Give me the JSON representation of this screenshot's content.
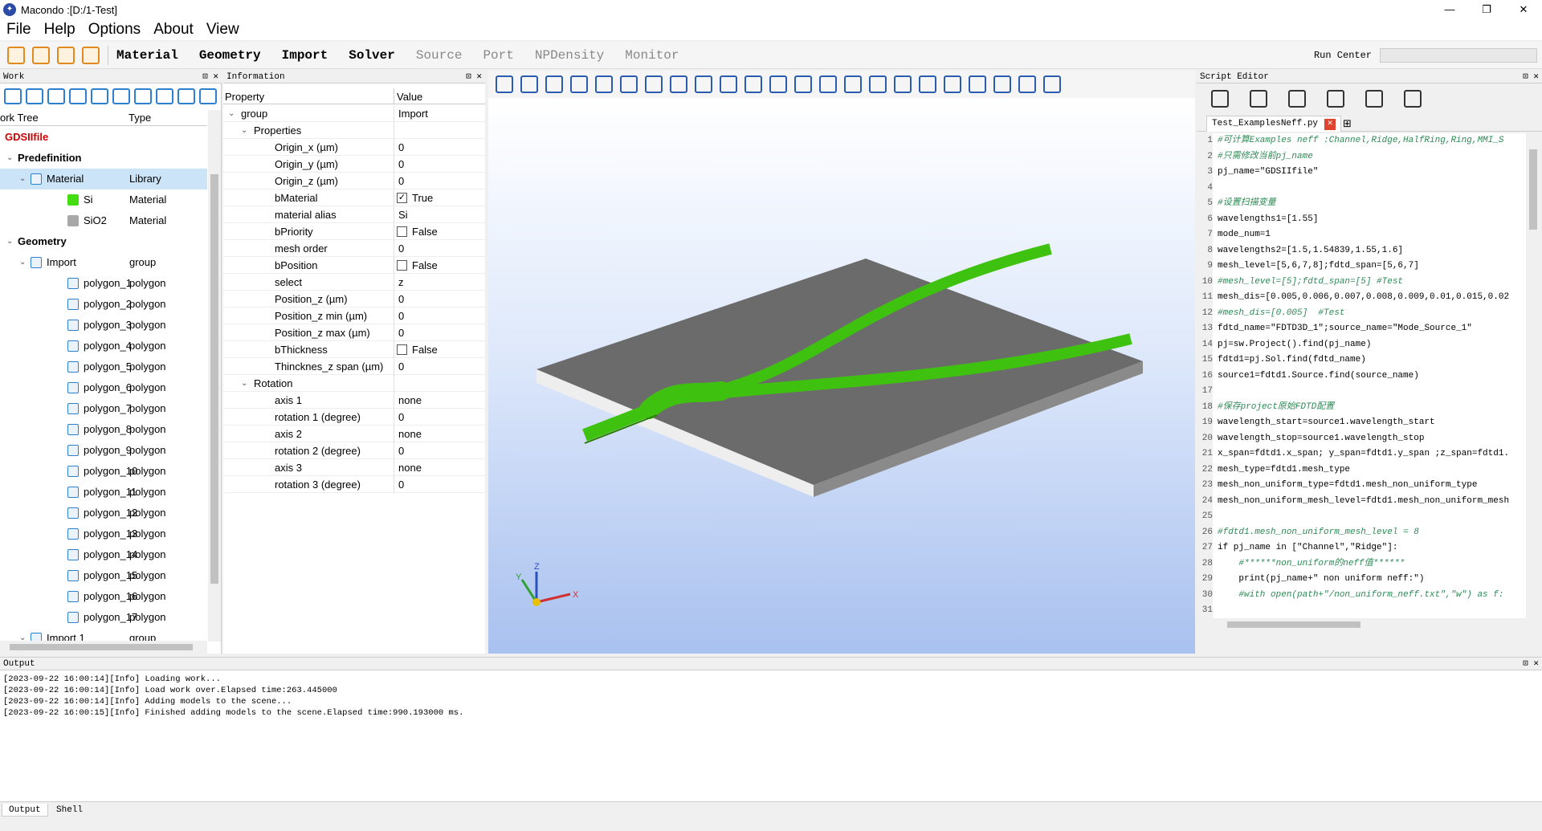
{
  "window": {
    "title": "Macondo :[D:/1-Test]",
    "controls": [
      "—",
      "❐",
      "✕"
    ]
  },
  "menubar": {
    "items": [
      "File",
      "Help",
      "Options",
      "About",
      "View"
    ]
  },
  "toolbar": {
    "menus": [
      {
        "label": "Material",
        "enabled": true
      },
      {
        "label": "Geometry",
        "enabled": true
      },
      {
        "label": "Import",
        "enabled": true
      },
      {
        "label": "Solver",
        "enabled": true
      },
      {
        "label": "Source",
        "enabled": false
      },
      {
        "label": "Port",
        "enabled": false
      },
      {
        "label": "NPDensity",
        "enabled": false
      },
      {
        "label": "Monitor",
        "enabled": false
      }
    ],
    "run_center_label": "Run Center"
  },
  "work": {
    "panel_title": "Work",
    "controls": "⊡ ✕",
    "col_tree": "ork Tree",
    "col_type": "Type",
    "rows": [
      {
        "label": "GDSIIfile",
        "type": "",
        "level": 0,
        "arrow": "",
        "icon": "",
        "style": "root"
      },
      {
        "label": "Predefinition",
        "type": "",
        "level": 0,
        "arrow": "⌄",
        "icon": "",
        "style": "bold"
      },
      {
        "label": "Material",
        "type": "Library",
        "level": 1,
        "arrow": "⌄",
        "icon": "material-icon",
        "style": "sel"
      },
      {
        "label": "Si",
        "type": "Material",
        "level": 2,
        "arrow": "",
        "icon": "si-swatch",
        "style": ""
      },
      {
        "label": "SiO2",
        "type": "Material",
        "level": 2,
        "arrow": "",
        "icon": "sio2-swatch",
        "style": ""
      },
      {
        "label": "Geometry",
        "type": "",
        "level": 0,
        "arrow": "⌄",
        "icon": "",
        "style": "bold"
      },
      {
        "label": "Import",
        "type": "group",
        "level": 1,
        "arrow": "⌄",
        "icon": "group-icon",
        "style": ""
      },
      {
        "label": "polygon_1",
        "type": "polygon",
        "level": 2,
        "arrow": "",
        "icon": "polygon-icon",
        "style": ""
      },
      {
        "label": "polygon_2",
        "type": "polygon",
        "level": 2,
        "arrow": "",
        "icon": "polygon-icon",
        "style": ""
      },
      {
        "label": "polygon_3",
        "type": "polygon",
        "level": 2,
        "arrow": "",
        "icon": "polygon-icon",
        "style": ""
      },
      {
        "label": "polygon_4",
        "type": "polygon",
        "level": 2,
        "arrow": "",
        "icon": "polygon-icon",
        "style": ""
      },
      {
        "label": "polygon_5",
        "type": "polygon",
        "level": 2,
        "arrow": "",
        "icon": "polygon-icon",
        "style": ""
      },
      {
        "label": "polygon_6",
        "type": "polygon",
        "level": 2,
        "arrow": "",
        "icon": "polygon-icon",
        "style": ""
      },
      {
        "label": "polygon_7",
        "type": "polygon",
        "level": 2,
        "arrow": "",
        "icon": "polygon-icon",
        "style": ""
      },
      {
        "label": "polygon_8",
        "type": "polygon",
        "level": 2,
        "arrow": "",
        "icon": "polygon-icon",
        "style": ""
      },
      {
        "label": "polygon_9",
        "type": "polygon",
        "level": 2,
        "arrow": "",
        "icon": "polygon-icon",
        "style": ""
      },
      {
        "label": "polygon_10",
        "type": "polygon",
        "level": 2,
        "arrow": "",
        "icon": "polygon-icon",
        "style": ""
      },
      {
        "label": "polygon_11",
        "type": "polygon",
        "level": 2,
        "arrow": "",
        "icon": "polygon-icon",
        "style": ""
      },
      {
        "label": "polygon_12",
        "type": "polygon",
        "level": 2,
        "arrow": "",
        "icon": "polygon-icon",
        "style": ""
      },
      {
        "label": "polygon_13",
        "type": "polygon",
        "level": 2,
        "arrow": "",
        "icon": "polygon-icon",
        "style": ""
      },
      {
        "label": "polygon_14",
        "type": "polygon",
        "level": 2,
        "arrow": "",
        "icon": "polygon-icon",
        "style": ""
      },
      {
        "label": "polygon_15",
        "type": "polygon",
        "level": 2,
        "arrow": "",
        "icon": "polygon-icon",
        "style": ""
      },
      {
        "label": "polygon_16",
        "type": "polygon",
        "level": 2,
        "arrow": "",
        "icon": "polygon-icon",
        "style": ""
      },
      {
        "label": "polygon_17",
        "type": "polygon",
        "level": 2,
        "arrow": "",
        "icon": "polygon-icon",
        "style": ""
      },
      {
        "label": "Import 1",
        "type": "group",
        "level": 1,
        "arrow": "⌄",
        "icon": "group-icon",
        "style": ""
      }
    ],
    "colors": {
      "si": "#44dd11",
      "sio2": "#a8a8a8",
      "selection": "#cce4f7"
    }
  },
  "info": {
    "panel_title": "Information",
    "controls": "⊡ ✕",
    "col_property": "Property",
    "col_value": "Value",
    "rows": [
      {
        "k": "group",
        "v": "Import",
        "level": 0,
        "arrow": "⌄",
        "check": null
      },
      {
        "k": "Properties",
        "v": "",
        "level": 1,
        "arrow": "⌄",
        "check": null
      },
      {
        "k": "Origin_x (µm)",
        "v": "0",
        "level": 2,
        "arrow": "",
        "check": null
      },
      {
        "k": "Origin_y (µm)",
        "v": "0",
        "level": 2,
        "arrow": "",
        "check": null
      },
      {
        "k": "Origin_z (µm)",
        "v": "0",
        "level": 2,
        "arrow": "",
        "check": null
      },
      {
        "k": "bMaterial",
        "v": "True",
        "level": 2,
        "arrow": "",
        "check": true
      },
      {
        "k": "material alias",
        "v": "Si",
        "level": 2,
        "arrow": "",
        "check": null
      },
      {
        "k": "bPriority",
        "v": "False",
        "level": 2,
        "arrow": "",
        "check": false
      },
      {
        "k": "mesh order",
        "v": "0",
        "level": 2,
        "arrow": "",
        "check": null
      },
      {
        "k": "bPosition",
        "v": "False",
        "level": 2,
        "arrow": "",
        "check": false
      },
      {
        "k": "select",
        "v": "z",
        "level": 2,
        "arrow": "",
        "check": null
      },
      {
        "k": "Position_z (µm)",
        "v": "0",
        "level": 2,
        "arrow": "",
        "check": null
      },
      {
        "k": "Position_z min (µm)",
        "v": "0",
        "level": 2,
        "arrow": "",
        "check": null
      },
      {
        "k": "Position_z max (µm)",
        "v": "0",
        "level": 2,
        "arrow": "",
        "check": null
      },
      {
        "k": "bThickness",
        "v": "False",
        "level": 2,
        "arrow": "",
        "check": false
      },
      {
        "k": "Thincknes_z span (µm)",
        "v": "0",
        "level": 2,
        "arrow": "",
        "check": null
      },
      {
        "k": "Rotation",
        "v": "",
        "level": 1,
        "arrow": "⌄",
        "check": null
      },
      {
        "k": "axis 1",
        "v": "none",
        "level": 2,
        "arrow": "",
        "check": null
      },
      {
        "k": "rotation 1 (degree)",
        "v": "0",
        "level": 2,
        "arrow": "",
        "check": null
      },
      {
        "k": "axis 2",
        "v": "none",
        "level": 2,
        "arrow": "",
        "check": null
      },
      {
        "k": "rotation 2 (degree)",
        "v": "0",
        "level": 2,
        "arrow": "",
        "check": null
      },
      {
        "k": "axis 3",
        "v": "none",
        "level": 2,
        "arrow": "",
        "check": null
      },
      {
        "k": "rotation 3 (degree)",
        "v": "0",
        "level": 2,
        "arrow": "",
        "check": null
      }
    ]
  },
  "viewport": {
    "axis_labels": {
      "x": "X",
      "y": "Y",
      "z": "Z"
    },
    "colors": {
      "substrate": "#6b6b6b",
      "waveguide": "#3fc20f",
      "bg_top": "#ffffff",
      "bg_bottom": "#a9c1ef"
    }
  },
  "script": {
    "panel_title": "Script Editor",
    "controls": "⊡ ✕",
    "tab_label": "Test_ExamplesNeff.py",
    "tab_close": "✕",
    "tab_add": "⊞",
    "current_line": 4,
    "lines": [
      {
        "n": "1",
        "t": "#可计算Examples neff :Channel,Ridge,HalfRing,Ring,MMI_S",
        "c": "cm"
      },
      {
        "n": "2",
        "t": "#只需修改当前pj_name",
        "c": "cm"
      },
      {
        "n": "3",
        "t": "pj_name=\"GDSIIfile\"",
        "c": ""
      },
      {
        "n": "4",
        "t": "",
        "c": ""
      },
      {
        "n": "5",
        "t": "#设置扫描变量",
        "c": "cm"
      },
      {
        "n": "6",
        "t": "wavelengths1=[1.55]",
        "c": ""
      },
      {
        "n": "7",
        "t": "mode_num=1",
        "c": ""
      },
      {
        "n": "8",
        "t": "wavelengths2=[1.5,1.54839,1.55,1.6]",
        "c": ""
      },
      {
        "n": "9",
        "t": "mesh_level=[5,6,7,8];fdtd_span=[5,6,7]",
        "c": ""
      },
      {
        "n": "10",
        "t": "#mesh_level=[5];fdtd_span=[5] #Test",
        "c": "cm"
      },
      {
        "n": "11",
        "t": "mesh_dis=[0.005,0.006,0.007,0.008,0.009,0.01,0.015,0.02",
        "c": ""
      },
      {
        "n": "12",
        "t": "#mesh_dis=[0.005]  #Test",
        "c": "cm"
      },
      {
        "n": "13",
        "t": "fdtd_name=\"FDTD3D_1\";source_name=\"Mode_Source_1\"",
        "c": ""
      },
      {
        "n": "14",
        "t": "pj=sw.Project().find(pj_name)",
        "c": ""
      },
      {
        "n": "15",
        "t": "fdtd1=pj.Sol.find(fdtd_name)",
        "c": ""
      },
      {
        "n": "16",
        "t": "source1=fdtd1.Source.find(source_name)",
        "c": ""
      },
      {
        "n": "17",
        "t": "",
        "c": ""
      },
      {
        "n": "18",
        "t": "#保存project原始FDTD配置",
        "c": "cm"
      },
      {
        "n": "19",
        "t": "wavelength_start=source1.wavelength_start",
        "c": ""
      },
      {
        "n": "20",
        "t": "wavelength_stop=source1.wavelength_stop",
        "c": ""
      },
      {
        "n": "21",
        "t": "x_span=fdtd1.x_span; y_span=fdtd1.y_span ;z_span=fdtd1.",
        "c": ""
      },
      {
        "n": "22",
        "t": "mesh_type=fdtd1.mesh_type",
        "c": ""
      },
      {
        "n": "23",
        "t": "mesh_non_uniform_type=fdtd1.mesh_non_uniform_type",
        "c": ""
      },
      {
        "n": "24",
        "t": "mesh_non_uniform_mesh_level=fdtd1.mesh_non_uniform_mesh",
        "c": ""
      },
      {
        "n": "25",
        "t": "",
        "c": ""
      },
      {
        "n": "26",
        "t": "#fdtd1.mesh_non_uniform_mesh_level = 8",
        "c": "cm"
      },
      {
        "n": "27",
        "t": "if pj_name in [\"Channel\",\"Ridge\"]:",
        "c": ""
      },
      {
        "n": "28",
        "t": "    #******non_uniform的neff值******",
        "c": "cm"
      },
      {
        "n": "29",
        "t": "    print(pj_name+\" non uniform neff:\")",
        "c": ""
      },
      {
        "n": "30",
        "t": "    #with open(path+\"/non_uniform_neff.txt\",\"w\") as f:",
        "c": "cm"
      },
      {
        "n": "31",
        "t": "",
        "c": ""
      }
    ]
  },
  "output": {
    "panel_title": "Output",
    "controls": "⊡ ✕",
    "lines": [
      "[2023-09-22 16:00:14][Info] Loading work...",
      "[2023-09-22 16:00:14][Info] Load work over.Elapsed time:263.445000",
      "[2023-09-22 16:00:14][Info] Adding models to the scene...",
      "[2023-09-22 16:00:15][Info] Finished adding models to the scene.Elapsed time:990.193000 ms."
    ],
    "tabs": [
      "Output",
      "Shell"
    ]
  }
}
